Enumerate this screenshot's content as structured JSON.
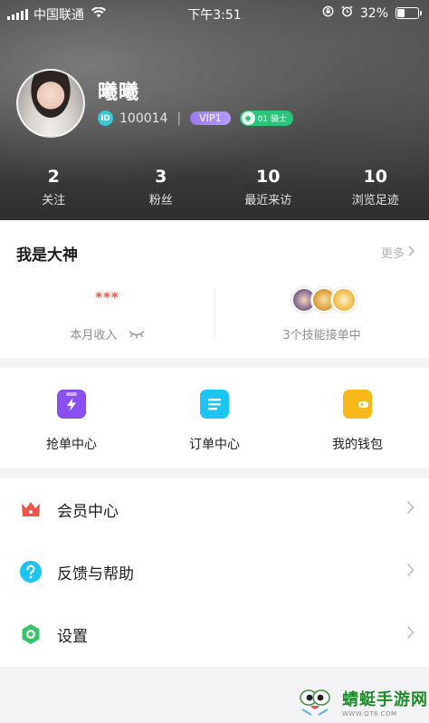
{
  "status_bar": {
    "carrier": "中国联通",
    "time": "下午3:51",
    "battery": "32%",
    "battery_level": 0.32
  },
  "profile": {
    "nickname": "曦曦",
    "id_badge": "ID",
    "id": "100014",
    "separator": "|",
    "vip": "VIP1",
    "knight_rank": "01 骑士"
  },
  "stats": [
    {
      "value": "2",
      "label": "关注"
    },
    {
      "value": "3",
      "label": "粉丝"
    },
    {
      "value": "10",
      "label": "最近来访"
    },
    {
      "value": "10",
      "label": "浏览足迹"
    }
  ],
  "god_section": {
    "title": "我是大神",
    "more": "更多",
    "income_masked": "***",
    "income_label": "本月收入",
    "skills_label": "3个技能接单中"
  },
  "functions": [
    {
      "label": "抢单中心",
      "icon": "lightning-order-icon",
      "color": "#8a4ff0"
    },
    {
      "label": "订单中心",
      "icon": "list-document-icon",
      "color": "#1cc4f2"
    },
    {
      "label": "我的钱包",
      "icon": "wallet-icon",
      "color": "#f8b81a"
    }
  ],
  "menu": [
    {
      "label": "会员中心",
      "icon": "crown-icon",
      "color": "#f25547"
    },
    {
      "label": "反馈与帮助",
      "icon": "question-icon",
      "color": "#1cc4f2"
    },
    {
      "label": "设置",
      "icon": "hexagon-settings-icon",
      "color": "#37c46c"
    }
  ],
  "watermark": {
    "name": "蜻蜓手游网",
    "url": "WWW.QT6.COM"
  }
}
